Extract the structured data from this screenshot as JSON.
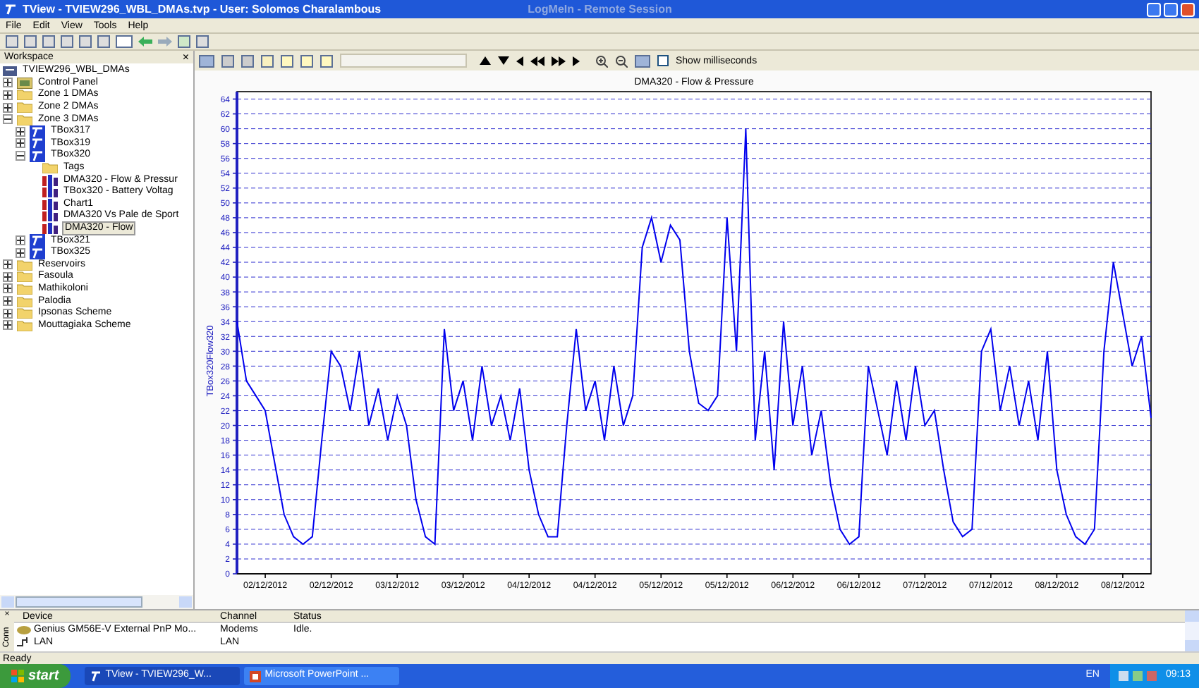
{
  "window": {
    "title": "TView - TVIEW296_WBL_DMAs.tvp - User: Solomos Charalambous",
    "overlay": "LogMeIn - Remote Session"
  },
  "menu": [
    "File",
    "Edit",
    "View",
    "Tools",
    "Help"
  ],
  "workspace": {
    "title": "Workspace",
    "close": "×",
    "tree": [
      {
        "label": "TVIEW296_WBL_DMAs",
        "kind": "root",
        "selected": false,
        "children": [
          {
            "label": "Control Panel",
            "kind": "panel",
            "expanded": false,
            "selected": false
          },
          {
            "label": "Zone 1 DMAs",
            "kind": "folder",
            "expanded": false,
            "selected": false
          },
          {
            "label": "Zone 2 DMAs",
            "kind": "folder",
            "expanded": false,
            "selected": false
          },
          {
            "label": "Zone 3 DMAs",
            "kind": "folder",
            "expanded": true,
            "selected": false,
            "children": [
              {
                "label": "TBox317",
                "kind": "tbox",
                "expanded": false,
                "selected": false
              },
              {
                "label": "TBox319",
                "kind": "tbox",
                "expanded": false,
                "selected": false
              },
              {
                "label": "TBox320",
                "kind": "tbox",
                "expanded": true,
                "selected": false,
                "children": [
                  {
                    "label": "Tags",
                    "kind": "leaf-folder",
                    "selected": false
                  },
                  {
                    "label": "DMA320 - Flow & Pressur",
                    "kind": "chart",
                    "selected": false
                  },
                  {
                    "label": "TBox320 - Battery Voltag",
                    "kind": "chart",
                    "selected": false
                  },
                  {
                    "label": "Chart1",
                    "kind": "chart",
                    "selected": false
                  },
                  {
                    "label": "DMA320 Vs Pale de Sport",
                    "kind": "chart",
                    "selected": false
                  },
                  {
                    "label": "DMA320 - Flow",
                    "kind": "chart",
                    "selected": true
                  }
                ]
              },
              {
                "label": "TBox321",
                "kind": "tbox",
                "expanded": false,
                "selected": false
              },
              {
                "label": "TBox325",
                "kind": "tbox",
                "expanded": false,
                "selected": false
              }
            ]
          },
          {
            "label": "Reservoirs",
            "kind": "folder",
            "expanded": false,
            "selected": false
          },
          {
            "label": "Fasoula",
            "kind": "folder",
            "expanded": false,
            "selected": false
          },
          {
            "label": "Mathikoloni",
            "kind": "folder",
            "expanded": false,
            "selected": false
          },
          {
            "label": "Palodia",
            "kind": "folder",
            "expanded": false,
            "selected": false
          },
          {
            "label": "Ipsonas Scheme",
            "kind": "folder",
            "expanded": false,
            "selected": false
          },
          {
            "label": "Mouttagiaka Scheme",
            "kind": "folder",
            "expanded": false,
            "selected": false
          }
        ]
      }
    ]
  },
  "chart_toolbar": {
    "show_milliseconds": {
      "label": "Show milliseconds",
      "checked": false
    }
  },
  "chart": {
    "chart_data": {
      "type": "line",
      "title": "DMA320 - Flow & Pressure",
      "grid": true,
      "ylim": [
        0,
        65
      ],
      "categories": [
        null,
        null,
        null,
        "02/12/2012",
        null,
        null,
        null,
        null,
        null,
        null,
        "02/12/2012",
        null,
        null,
        null,
        null,
        null,
        null,
        "03/12/2012",
        null,
        null,
        null,
        null,
        null,
        null,
        "03/12/2012",
        null,
        null,
        null,
        null,
        null,
        null,
        "04/12/2012",
        null,
        null,
        null,
        null,
        null,
        null,
        "04/12/2012",
        null,
        null,
        null,
        null,
        null,
        null,
        "05/12/2012",
        null,
        null,
        null,
        null,
        null,
        null,
        "05/12/2012",
        null,
        null,
        null,
        null,
        null,
        null,
        "06/12/2012",
        null,
        null,
        null,
        null,
        null,
        null,
        "06/12/2012",
        null,
        null,
        null,
        null,
        null,
        null,
        "07/12/2012",
        null,
        null,
        null,
        null,
        null,
        null,
        "07/12/2012",
        null,
        null,
        null,
        null,
        null,
        null,
        "08/12/2012",
        null,
        null,
        null,
        null,
        null,
        null,
        "08/12/2012",
        null,
        null,
        null
      ],
      "yticks": [
        0,
        2,
        4,
        6,
        8,
        10,
        12,
        14,
        16,
        18,
        20,
        22,
        24,
        26,
        28,
        30,
        32,
        34,
        36,
        38,
        40,
        42,
        44,
        46,
        48,
        50,
        52,
        54,
        56,
        58,
        60,
        62,
        64
      ],
      "series": [
        {
          "name": "TBox320Flow320",
          "color": "#0000ee",
          "values": [
            34,
            26,
            24,
            22,
            15,
            8,
            5,
            4,
            5,
            18,
            30,
            28,
            22,
            30,
            20,
            25,
            18,
            24,
            20,
            10,
            5,
            4,
            33,
            22,
            26,
            18,
            28,
            20,
            24,
            18,
            25,
            14,
            8,
            5,
            5,
            20,
            33,
            22,
            26,
            18,
            28,
            20,
            24,
            44,
            48,
            42,
            47,
            45,
            30,
            23,
            22,
            24,
            48,
            30,
            60,
            18,
            30,
            14,
            34,
            20,
            28,
            16,
            22,
            12,
            6,
            4,
            5,
            28,
            22,
            16,
            26,
            18,
            28,
            20,
            22,
            14,
            7,
            5,
            6,
            30,
            33,
            22,
            28,
            20,
            26,
            18,
            30,
            14,
            8,
            5,
            4,
            6,
            30,
            42,
            35,
            28,
            32,
            21
          ]
        }
      ]
    }
  },
  "devices": {
    "tab": "Conn",
    "close": "×",
    "columns": [
      "Device",
      "Channel",
      "Status"
    ],
    "rows": [
      {
        "kind": "modem",
        "cells": [
          "Genius GM56E-V External PnP Mo...",
          "Modems",
          "Idle."
        ]
      },
      {
        "kind": "lan",
        "cells": [
          "LAN",
          "LAN",
          ""
        ]
      }
    ]
  },
  "status_bar": {
    "text": "Ready"
  },
  "taskbar": {
    "start": "start",
    "tasks": [
      {
        "label": "TView - TVIEW296_W...",
        "kind": "tview",
        "selected": true
      },
      {
        "label": "Microsoft PowerPoint ...",
        "kind": "ppt",
        "selected": false
      }
    ],
    "language": "EN",
    "clock": "09:13"
  }
}
